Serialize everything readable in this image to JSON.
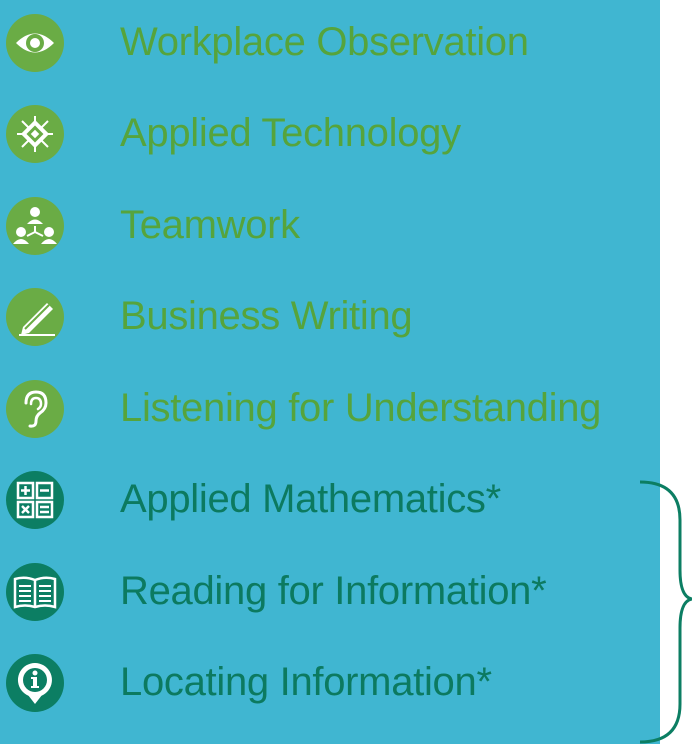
{
  "items": [
    {
      "label": "Workplace Observation",
      "icon": "eye-icon"
    },
    {
      "label": "Applied Technology",
      "icon": "chip-icon"
    },
    {
      "label": "Teamwork",
      "icon": "team-icon"
    },
    {
      "label": "Business Writing",
      "icon": "pencil-icon"
    },
    {
      "label": "Listening for Understanding",
      "icon": "ear-icon"
    },
    {
      "label": "Applied Mathematics*",
      "icon": "calculator-icon"
    },
    {
      "label": "Reading for Information*",
      "icon": "book-icon"
    },
    {
      "label": "Locating Information*",
      "icon": "info-pin-icon"
    }
  ],
  "colors": {
    "panel": "#40b6d1",
    "light_green": "#6aac45",
    "dark_green": "#0c7e63"
  }
}
